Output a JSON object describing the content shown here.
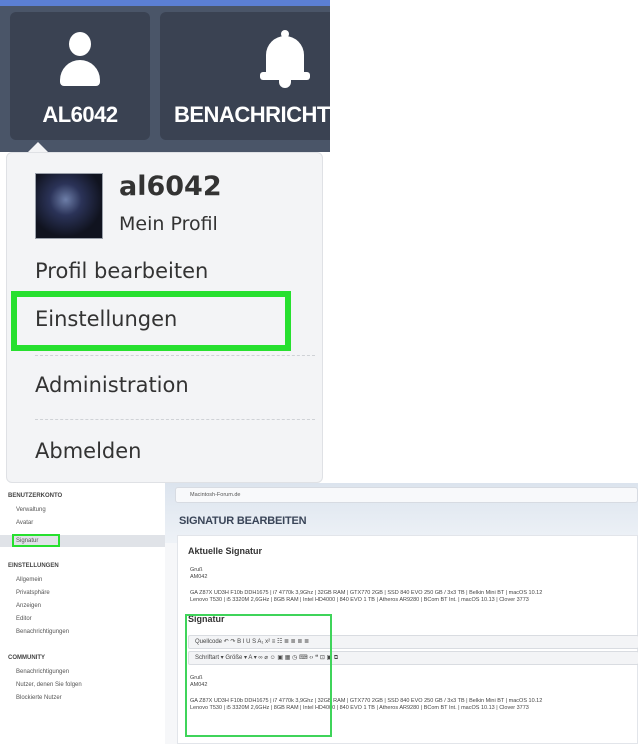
{
  "user_menu": {
    "tabs": [
      {
        "label": "AL6042",
        "icon": "user-icon"
      },
      {
        "label": "BENACHRICHTIGU",
        "icon": "bell-icon"
      }
    ],
    "profile": {
      "username": "al6042",
      "my_profile_label": "Mein Profil"
    },
    "items": [
      {
        "label": "Profil bearbeiten"
      },
      {
        "label": "Einstellungen",
        "highlighted": true
      },
      {
        "label": "Administration"
      },
      {
        "label": "Abmelden"
      }
    ],
    "colors": {
      "tab_bg": "#3a4252",
      "menu_bg": "#f3f4f6",
      "highlight": "#27e02f"
    }
  },
  "settings_page": {
    "sidebar": {
      "groups": [
        {
          "heading": "BENUTZERKONTO",
          "items": [
            "Verwaltung",
            "Avatar",
            "Signatur"
          ],
          "active": "Signatur"
        },
        {
          "heading": "EINSTELLUNGEN",
          "items": [
            "Allgemein",
            "Privatsphäre",
            "Anzeigen",
            "Editor",
            "Benachrichtigungen"
          ]
        },
        {
          "heading": "COMMUNITY",
          "items": [
            "Benachrichtigungen",
            "Nutzer, denen Sie folgen",
            "Blockierte Nutzer"
          ]
        }
      ]
    },
    "breadcrumb": "Macintosh-Forum.de",
    "title": "SIGNATUR BEARBEITEN",
    "current_signature": {
      "heading": "Aktuelle Signatur",
      "lines": [
        "Gruß",
        "AM042",
        "GA Z87X UD3H F10b DDH1675 | i7 4770k 3,9Ghz | 32GB RAM | GTX770 2GB | SSD 840 EVO 250 GB / 3x3 TB | Belkin Mini BT | macOS 10.12",
        "Lenovo T530 | i5 3320M 2,6GHz | 8GB RAM | Intel HD4000 | 840 EVO 1 TB | Atheros AR9280 | BCom BT Int. | macOS 10.13 | Clover 3773"
      ]
    },
    "signature_editor": {
      "heading": "Signatur",
      "toolbar_row1": "Quellcode  ↶ ↷  B  I  U  S  A₁ x²  ≡ ☷  ≣ ≣ ≣ ≣",
      "toolbar_row2": "Schriftart ▾  Größe ▾  A ▾  ∞ ⌀  ☺ ▣ ▦ ◷  ⌨ ‹› ❝ ⊡ ▣ ⧉",
      "lines": [
        "Gruß",
        "AM042",
        "GA Z87X UD3H F10b DDH1675 | i7 4770k 3,9Ghz | 32GB RAM | GTX770 2GB | SSD 840 EVO 250 GB / 3x3 TB | Belkin Mini BT | macOS 10.12",
        "Lenovo T530 | i5 3320M 2,6GHz | 8GB RAM | Intel HD4000 | 840 EVO 1 TB | Atheros AR9280 | BCom BT Int. | macOS 10.13 | Clover 3773"
      ]
    }
  }
}
